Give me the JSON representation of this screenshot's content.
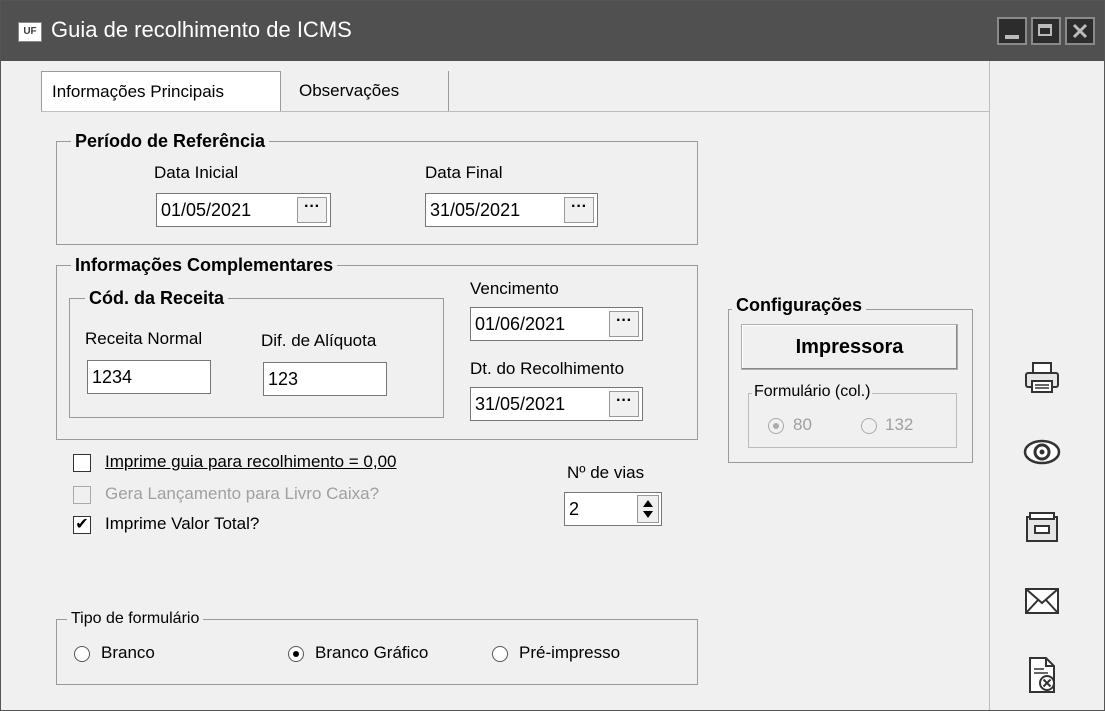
{
  "window": {
    "title": "Guia de recolhimento de ICMS",
    "app_icon_text": "UF"
  },
  "tabs": [
    {
      "label": "Informações Principais",
      "active": true
    },
    {
      "label": "Observações",
      "active": false
    }
  ],
  "periodo": {
    "title": "Período de Referência",
    "data_inicial_label": "Data Inicial",
    "data_inicial_value": "01/05/2021",
    "data_final_label": "Data Final",
    "data_final_value": "31/05/2021"
  },
  "complementares": {
    "title": "Informações Complementares",
    "cod_receita_title": "Cód. da Receita",
    "receita_normal_label": "Receita Normal",
    "receita_normal_value": "1234",
    "dif_aliquota_label": "Dif. de Alíquota",
    "dif_aliquota_value": "123",
    "vencimento_label": "Vencimento",
    "vencimento_value": "01/06/2021",
    "dt_recolhimento_label": "Dt. do Recolhimento",
    "dt_recolhimento_value": "31/05/2021"
  },
  "date_button_glyph": "···",
  "options": {
    "imprime_guia_label": "Imprime guia para recolhimento = 0,00",
    "imprime_guia_checked": false,
    "gera_lancamento_label": "Gera Lançamento para Livro Caixa?",
    "gera_lancamento_checked": false,
    "imprime_valor_label": "Imprime Valor Total?",
    "imprime_valor_checked": true,
    "check_mark": "✔"
  },
  "vias": {
    "label": "Nº de vias",
    "value": "2"
  },
  "configuracoes": {
    "title": "Configurações",
    "impressora_button": "Impressora",
    "formulario_title": "Formulário (col.)",
    "option_80": "80",
    "option_132": "132"
  },
  "tipo_formulario": {
    "title": "Tipo de formulário",
    "branco": "Branco",
    "branco_grafico": "Branco Gráfico",
    "pre_impresso": "Pré-impresso",
    "selected": "Branco Gráfico"
  },
  "side_icons": [
    "printer-icon",
    "eye-icon",
    "folder-icon",
    "mail-icon",
    "document-cancel-icon"
  ],
  "colors": {
    "titlebar": "#505050",
    "panel": "#f0f0f0",
    "title_text": "#ffffff"
  }
}
